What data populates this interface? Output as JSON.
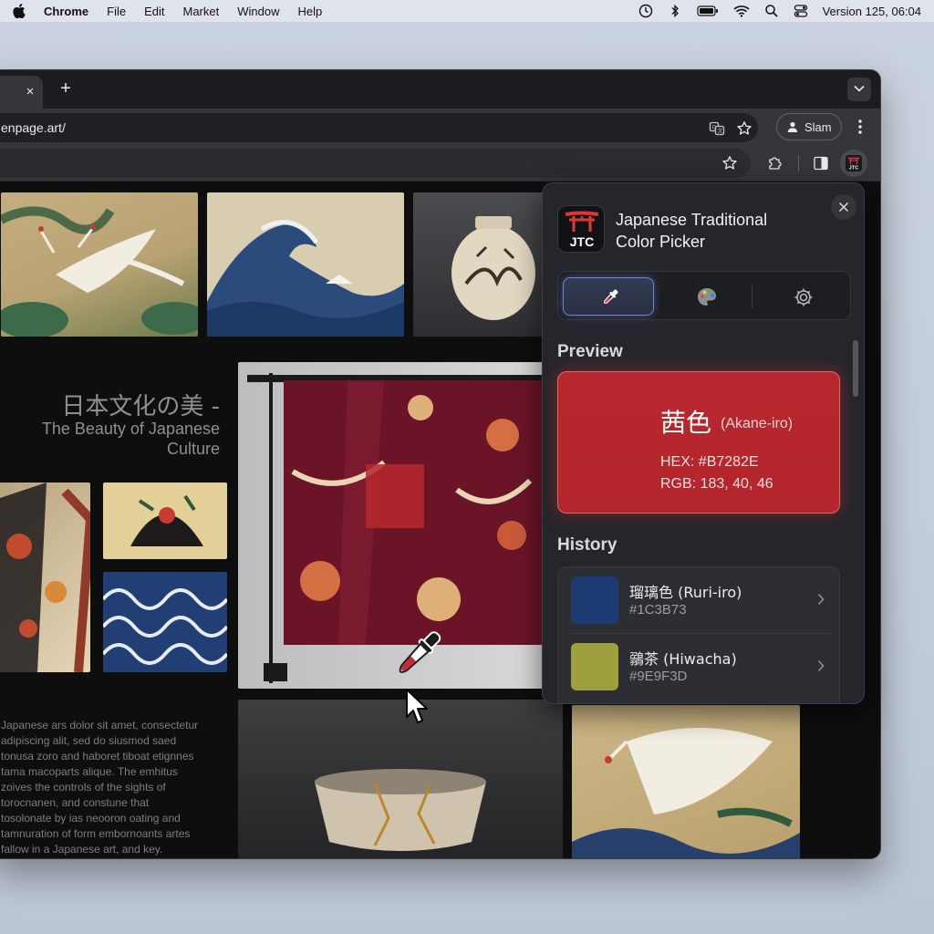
{
  "menubar": {
    "app": "Chrome",
    "menus": [
      "File",
      "Edit",
      "Market",
      "Window",
      "Help"
    ],
    "status": "Version 125,  06:04"
  },
  "browser": {
    "url": "enpage.art/",
    "profile": "Slam",
    "tab_close": "×",
    "new_tab": "+"
  },
  "page": {
    "heading_jp": "日本文化の美 -",
    "heading_en_1": "The Beauty of Japanese",
    "heading_en_2": "Culture",
    "body_lines": [
      "Japanese ars dolor sit amet, consectetur",
      "adipiscing alit, sed do siusmod saed",
      "tonusa zoro and haboret tiboat etignnes",
      "tama macoparts alique. The emhitus",
      "zoives the controls of the sights of",
      "torocnanen, and constune that",
      "tosolonate by ias neooron oating and",
      "tamnuration of form embornoants artes",
      "fallow in a Japanese art, and key."
    ]
  },
  "extension": {
    "logo_text": "JTC",
    "title_1": "Japanese Traditional",
    "title_2": "Color Picker",
    "preview_label": "Preview",
    "preview": {
      "name_jp": "茜色",
      "name_romaji": "(Akane-iro)",
      "hex": "HEX: #B7282E",
      "rgb": "RGB: 183, 40, 46",
      "color": "#B7282E"
    },
    "history_label": "History",
    "history": [
      {
        "name": "瑠璃色 (Ruri-iro)",
        "hex": "#1C3B73",
        "color": "#1C3B73"
      },
      {
        "name": "鶸茶 (Hiwacha)",
        "hex": "#9E9F3D",
        "color": "#9E9F3D"
      }
    ]
  }
}
